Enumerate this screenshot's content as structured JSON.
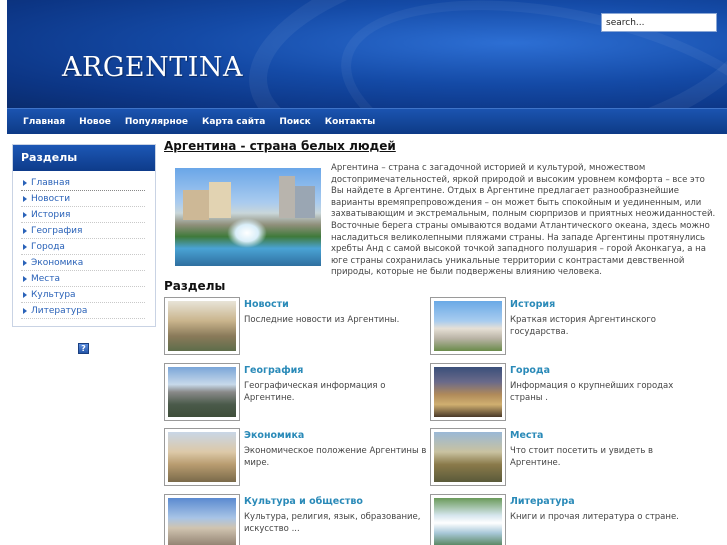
{
  "header": {
    "site_title": "ARGENTINA",
    "search_value": "search..."
  },
  "nav": {
    "items": [
      "Главная",
      "Новое",
      "Популярное",
      "Карта сайта",
      "Поиск",
      "Контакты"
    ]
  },
  "sidebar": {
    "title": "Разделы",
    "items": [
      "Главная",
      "Новости",
      "История",
      "География",
      "Города",
      "Экономика",
      "Места",
      "Культура",
      "Литература"
    ],
    "help_icon_label": "?"
  },
  "main": {
    "title": "Аргентина - страна белых людей",
    "intro": "Аргентина – страна с загадочной историей и культурой, множеством достопримечательностей, яркой природой и высоким уровнем комфорта – все это Вы найдете в Аргентине. Отдых в Аргентине предлагает разнообразнейшие варианты времяпрепровождения – он может быть спокойным и уединенным, или захватывающим и экстремальным, полным сюрпризов и приятных неожиданностей. Восточные берега страны омываются водами Атлантического океана, здесь можно насладиться великолепными пляжами страны. На западе Аргентины протянулись хребты Анд с самой высокой точкой западного полушария – горой Аконкагуа, а на юге страны сохранилась уникальные территории с контрастами девственной природы, которые не были подвержены влиянию человека.",
    "sections_heading": "Разделы",
    "sections": [
      {
        "title": "Новости",
        "desc": "Последние новости из Аргентины."
      },
      {
        "title": "История",
        "desc": "Краткая история Аргентинского государства."
      },
      {
        "title": "География",
        "desc": "Географическая информация о Аргентине."
      },
      {
        "title": "Города",
        "desc": "Информация о крупнейших городах страны ."
      },
      {
        "title": "Экономика",
        "desc": "Экономическое положение Аргентины в мире."
      },
      {
        "title": "Места",
        "desc": "Что стоит посетить и увидеть в Аргентине."
      },
      {
        "title": "Культура и общество",
        "desc": "Культура, религия, язык, образование, искусство ..."
      },
      {
        "title": "Литература",
        "desc": "Книги и прочая литература о стране."
      }
    ]
  },
  "colors": {
    "header_blue": "#144aa6",
    "nav_blue": "#0d3a86",
    "link_blue": "#2a8ab8",
    "sidebar_link": "#2a62b8"
  }
}
